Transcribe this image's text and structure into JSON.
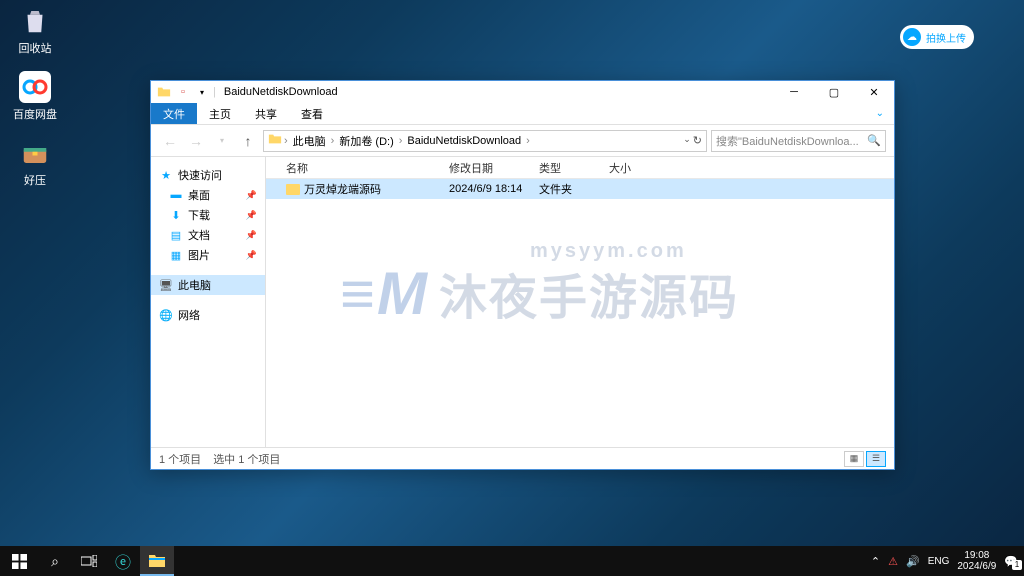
{
  "desktop": {
    "icons": [
      {
        "name": "回收站",
        "glyph": "🗑"
      },
      {
        "name": "百度网盘",
        "glyph": "∞"
      },
      {
        "name": "好压",
        "glyph": "📦"
      }
    ]
  },
  "upload_badge": "拍换上传",
  "watermark": {
    "url": "mysyym.com",
    "text": "沐夜手游源码"
  },
  "explorer": {
    "title": "BaiduNetdiskDownload",
    "tabs": {
      "file": "文件",
      "home": "主页",
      "share": "共享",
      "view": "查看"
    },
    "path": [
      "此电脑",
      "新加卷 (D:)",
      "BaiduNetdiskDownload"
    ],
    "search_placeholder": "搜索\"BaiduNetdiskDownloa...",
    "sidebar": {
      "quick_access": "快速访问",
      "quick_items": [
        {
          "label": "桌面",
          "glyph": "🟦"
        },
        {
          "label": "下载",
          "glyph": "⬇"
        },
        {
          "label": "文档",
          "glyph": "📄"
        },
        {
          "label": "图片",
          "glyph": "🖼"
        }
      ],
      "this_pc": "此电脑",
      "network": "网络"
    },
    "columns": {
      "name": "名称",
      "date": "修改日期",
      "type": "类型",
      "size": "大小"
    },
    "rows": [
      {
        "name": "万灵焯龙端源码",
        "date": "2024/6/9 18:14",
        "type": "文件夹",
        "size": ""
      }
    ],
    "status": {
      "count": "1 个项目",
      "selected": "选中 1 个项目"
    }
  },
  "taskbar": {
    "lang": "ENG",
    "time": "19:08",
    "date": "2024/6/9"
  }
}
